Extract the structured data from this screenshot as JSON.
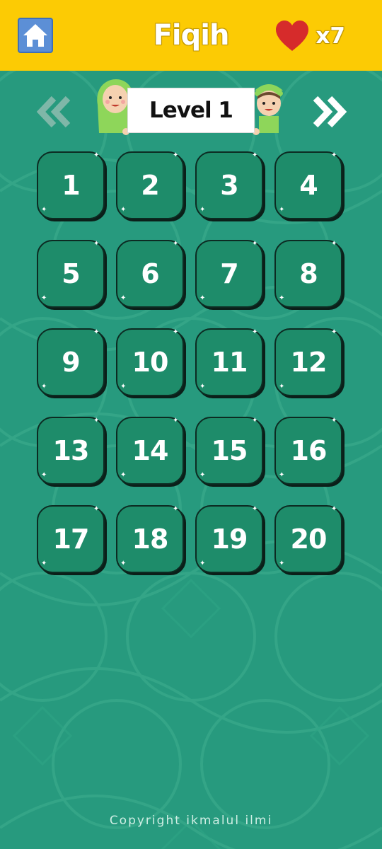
{
  "header": {
    "title": "Fiqih",
    "lives_count": "x7",
    "home_icon": "home-icon",
    "heart_icon": "heart-icon"
  },
  "level_selector": {
    "label": "Level 1",
    "prev_icon": "double-chevron-left-icon",
    "next_icon": "double-chevron-right-icon"
  },
  "levels": [
    "1",
    "2",
    "3",
    "4",
    "5",
    "6",
    "7",
    "8",
    "9",
    "10",
    "11",
    "12",
    "13",
    "14",
    "15",
    "16",
    "17",
    "18",
    "19",
    "20"
  ],
  "footer": {
    "copyright": "Copyright ikmalul ilmi"
  },
  "colors": {
    "header_bg": "#FCCB04",
    "page_bg": "#279A7E",
    "button_bg": "#1E8C6A",
    "heart": "#D62B2B"
  }
}
